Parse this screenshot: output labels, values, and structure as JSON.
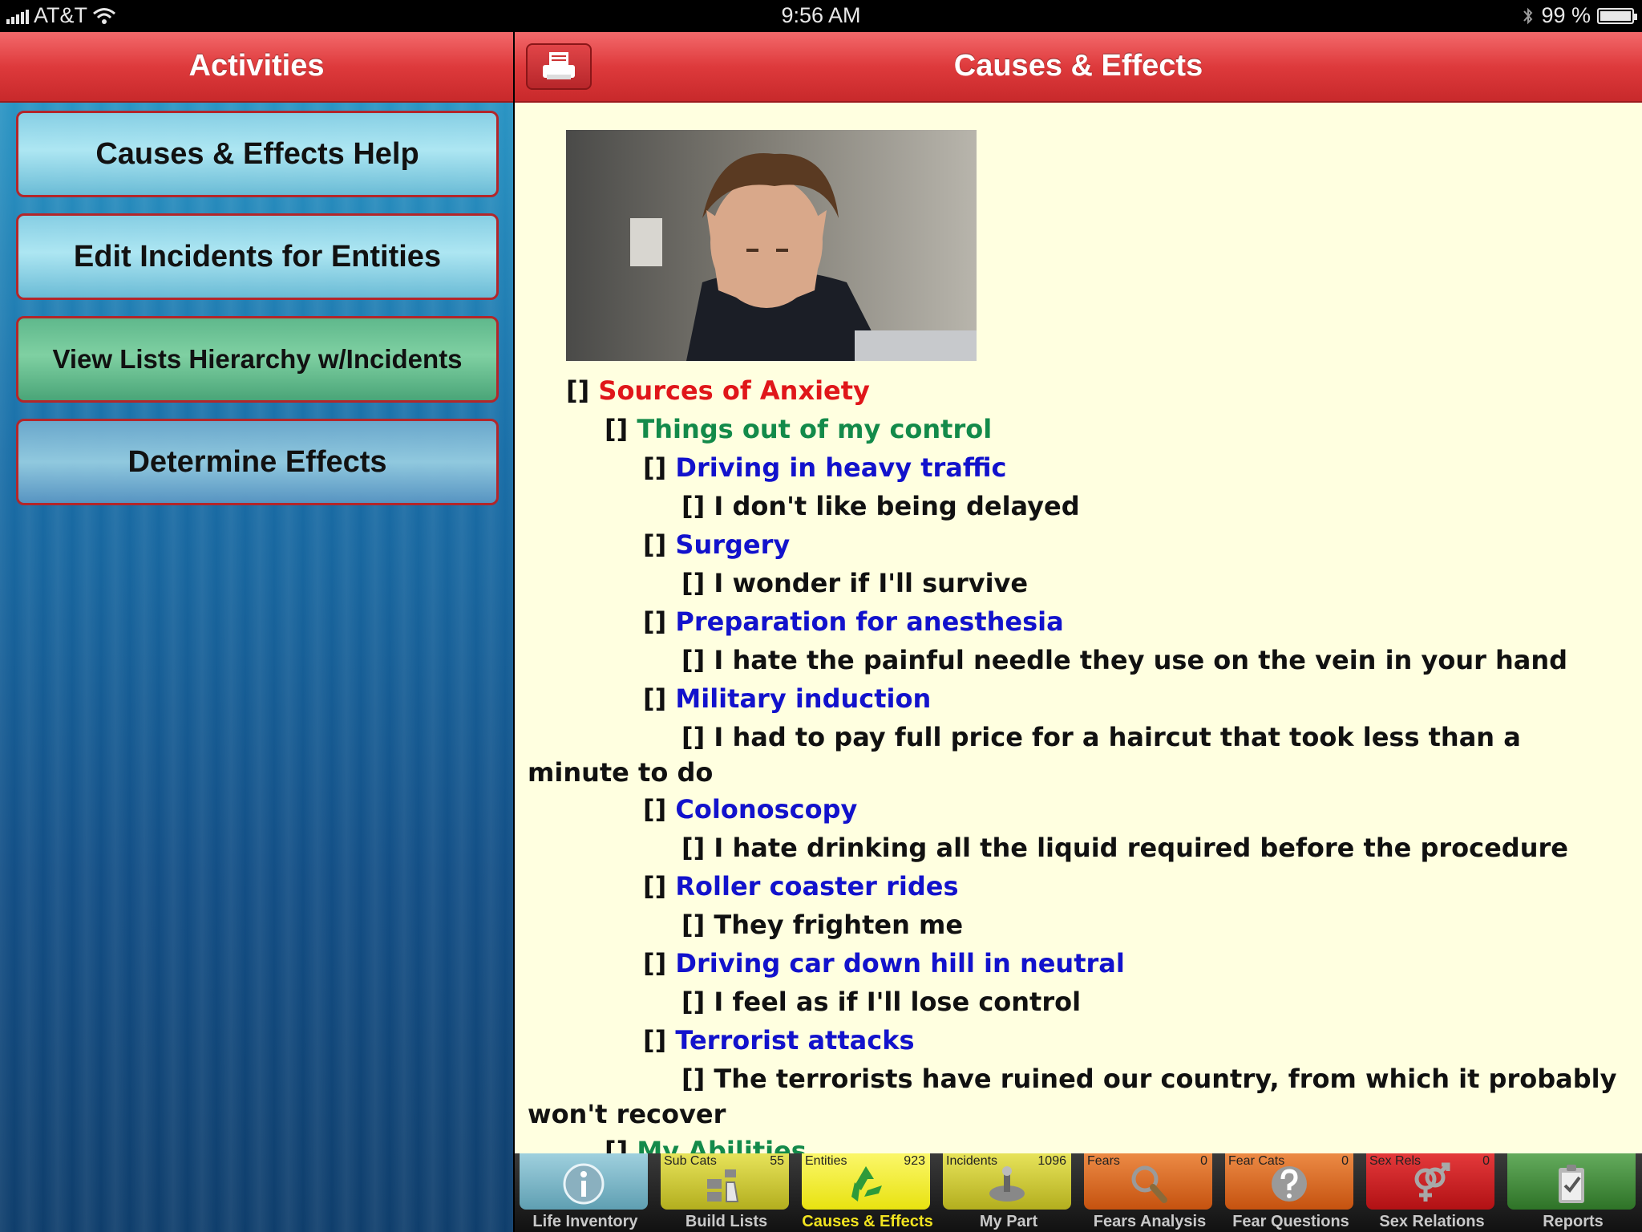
{
  "status": {
    "carrier": "AT&T",
    "time": "9:56 AM",
    "battery": "99 %"
  },
  "left": {
    "title": "Activities",
    "buttons": [
      "Causes & Effects Help",
      "Edit Incidents for Entities",
      "View Lists Hierarchy w/Incidents",
      "Determine Effects"
    ]
  },
  "right": {
    "title": "Causes & Effects",
    "checkbox": "[]",
    "lines": [
      "Sources of Anxiety",
      "Things out of my control",
      "Driving in heavy traffic",
      "I don't like being delayed",
      "Surgery",
      "I wonder if I'll survive",
      "Preparation for anesthesia",
      "I hate the painful needle they use on the vein in your hand",
      "Military induction",
      "I had to pay full price for a haircut that took less than a",
      "minute to do",
      "Colonoscopy",
      "I hate drinking all the liquid required before the procedure",
      "Roller coaster rides",
      "They frighten me",
      "Driving car down hill in neutral",
      "I feel as if I'll lose control",
      "Terrorist attacks",
      "The terrorists have ruined our country, from which it probably",
      "won't recover",
      "My Abilities"
    ]
  },
  "tabs": [
    {
      "label": "Life Inventory",
      "top_left": "",
      "top_right": "",
      "color": "#7ab6c7",
      "icon": "info-icon"
    },
    {
      "label": "Build Lists",
      "top_left": "Sub Cats",
      "top_right": "55",
      "color": "#c9c52a",
      "icon": "build-icon"
    },
    {
      "label": "Causes & Effects",
      "top_left": "Entities",
      "top_right": "923",
      "color": "#f2ee21",
      "icon": "recycle-icon"
    },
    {
      "label": "My Part",
      "top_left": "Incidents",
      "top_right": "1096",
      "color": "#c9c52a",
      "icon": "mypart-icon"
    },
    {
      "label": "Fears Analysis",
      "top_left": "Fears",
      "top_right": "0",
      "color": "#d9621d",
      "icon": "magnifier-icon"
    },
    {
      "label": "Fear Questions",
      "top_left": "Fear Cats",
      "top_right": "0",
      "color": "#d9621d",
      "icon": "question-icon"
    },
    {
      "label": "Sex Relations",
      "top_left": "Sex Rels",
      "top_right": "0",
      "color": "#c8181b",
      "icon": "gender-icon"
    },
    {
      "label": "Reports",
      "top_left": "",
      "top_right": "",
      "color": "#3f8a3a",
      "icon": "clipboard-icon"
    }
  ]
}
